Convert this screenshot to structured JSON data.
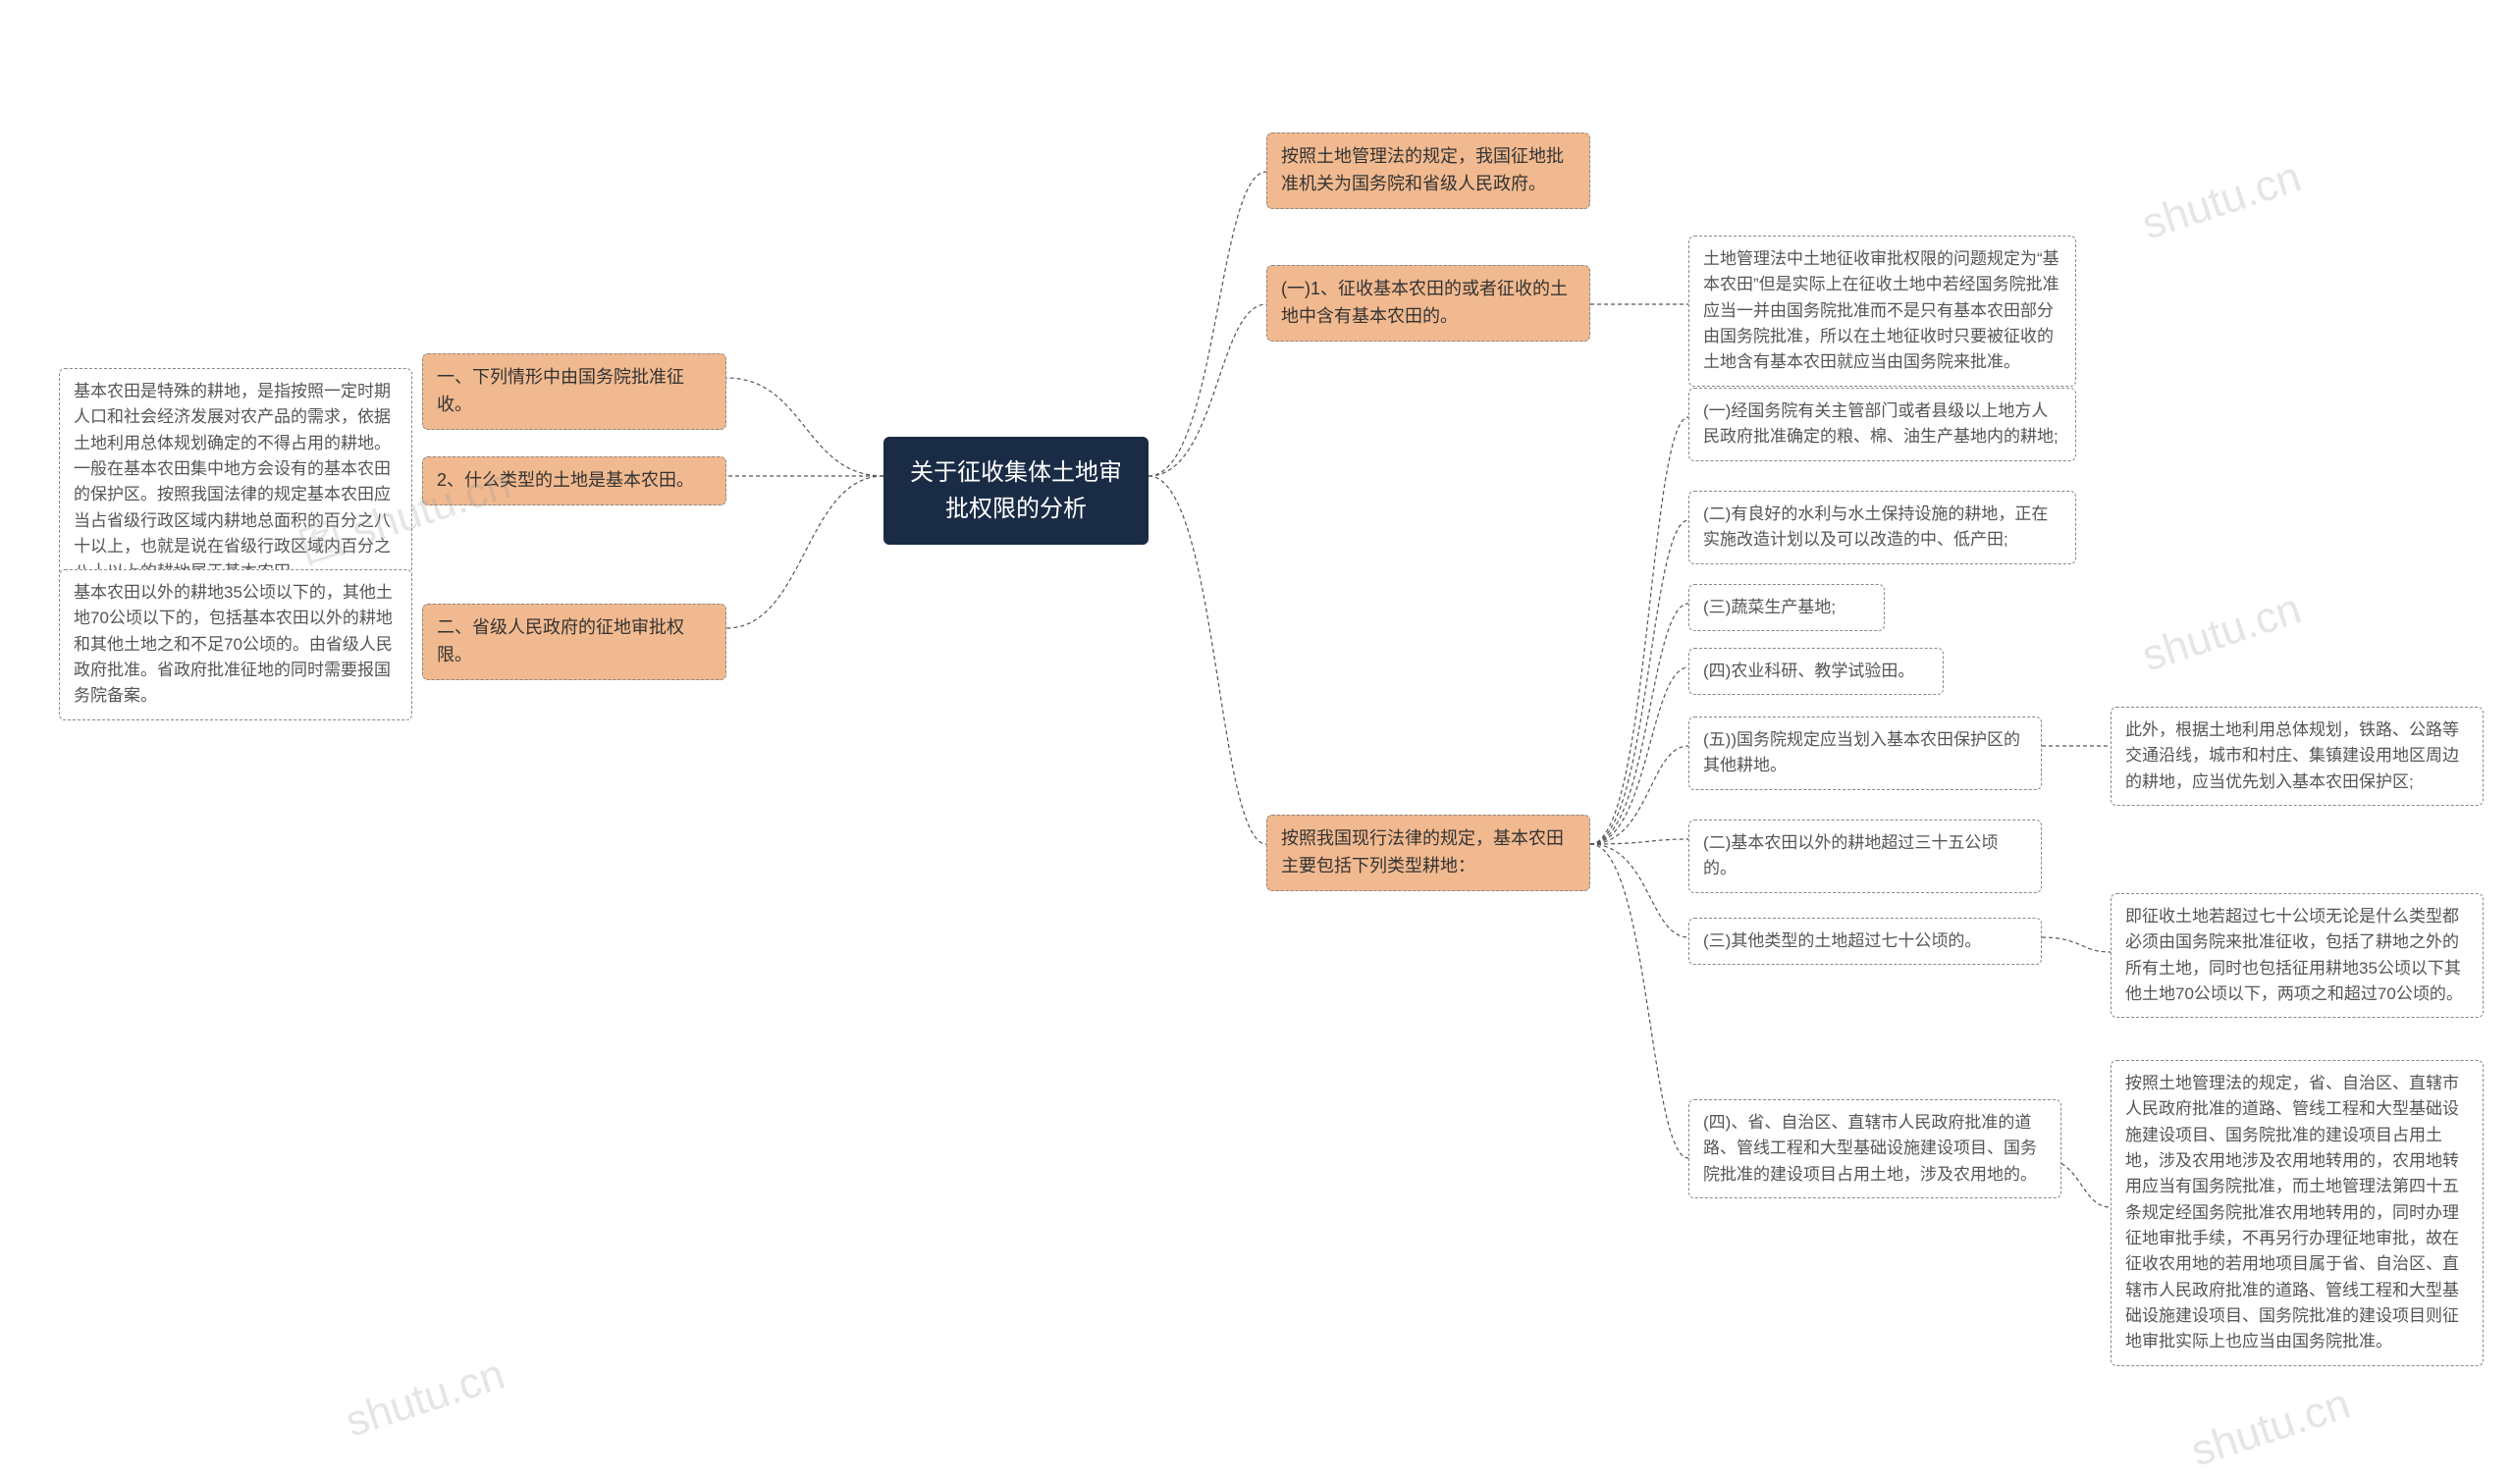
{
  "root": {
    "title": "关于征收集体土地审批权限的分析"
  },
  "left": {
    "n1": "一、下列情形中由国务院批准征收。",
    "n2": "2、什么类型的土地是基本农田。",
    "n2_leaf": "基本农田是特殊的耕地，是指按照一定时期人口和社会经济发展对农产品的需求，依据土地利用总体规划确定的不得占用的耕地。一般在基本农田集中地方会设有的基本农田的保护区。按照我国法律的规定基本农田应当占省级行政区域内耕地总面积的百分之八十以上，也就是说在省级行政区域内百分之八十以上的耕地属于基本农田。",
    "n3": "二、省级人民政府的征地审批权限。",
    "n3_leaf": "基本农田以外的耕地35公顷以下的，其他土地70公顷以下的，包括基本农田以外的耕地和其他土地之和不足70公顷的。由省级人民政府批准。省政府批准征地的同时需要报国务院备案。"
  },
  "right": {
    "r1": "按照土地管理法的规定，我国征地批准机关为国务院和省级人民政府。",
    "r2": "(一)1、征收基本农田的或者征收的土地中含有基本农田的。",
    "r2_leaf": "土地管理法中土地征收审批权限的问题规定为“基本农田”但是实际上在征收土地中若经国务院批准应当一并由国务院批准而不是只有基本农田部分由国务院批准，所以在土地征收时只要被征收的土地含有基本农田就应当由国务院来批准。",
    "r3": "按照我国现行法律的规定，基本农田主要包括下列类型耕地：",
    "r3_items": {
      "a": "(一)经国务院有关主管部门或者县级以上地方人民政府批准确定的粮、棉、油生产基地内的耕地;",
      "b": "(二)有良好的水利与水土保持设施的耕地，正在实施改造计划以及可以改造的中、低产田;",
      "c": "(三)蔬菜生产基地;",
      "d": "(四)农业科研、教学试验田。",
      "e": "(五))国务院规定应当划入基本农田保护区的其他耕地。",
      "e_leaf": "此外，根据土地利用总体规划，铁路、公路等交通沿线，城市和村庄、集镇建设用地区周边的耕地，应当优先划入基本农田保护区;",
      "f": "(二)基本农田以外的耕地超过三十五公顷的。",
      "g": "(三)其他类型的土地超过七十公顷的。",
      "g_leaf": "即征收土地若超过七十公顷无论是什么类型都必须由国务院来批准征收，包括了耕地之外的所有土地，同时也包括征用耕地35公顷以下其他土地70公顷以下，两项之和超过70公顷的。",
      "h": "(四)、省、自治区、直辖市人民政府批准的道路、管线工程和大型基础设施建设项目、国务院批准的建设项目占用土地，涉及农用地的。",
      "h_leaf": "按照土地管理法的规定，省、自治区、直辖市人民政府批准的道路、管线工程和大型基础设施建设项目、国务院批准的建设项目占用土地，涉及农用地涉及农用地转用的，农用地转用应当有国务院批准，而土地管理法第四十五条规定经国务院批准农用地转用的，同时办理征地审批手续，不再另行办理征地审批，故在征收农用地的若用地项目属于省、自治区、直辖市人民政府批准的道路、管线工程和大型基础设施建设项目、国务院批准的建设项目则征地审批实际上也应当由国务院批准。"
    }
  },
  "watermarks": [
    "图 shutu.cn",
    "shutu.cn",
    "shutu.cn",
    "shutu.cn",
    "shutu.cn"
  ]
}
